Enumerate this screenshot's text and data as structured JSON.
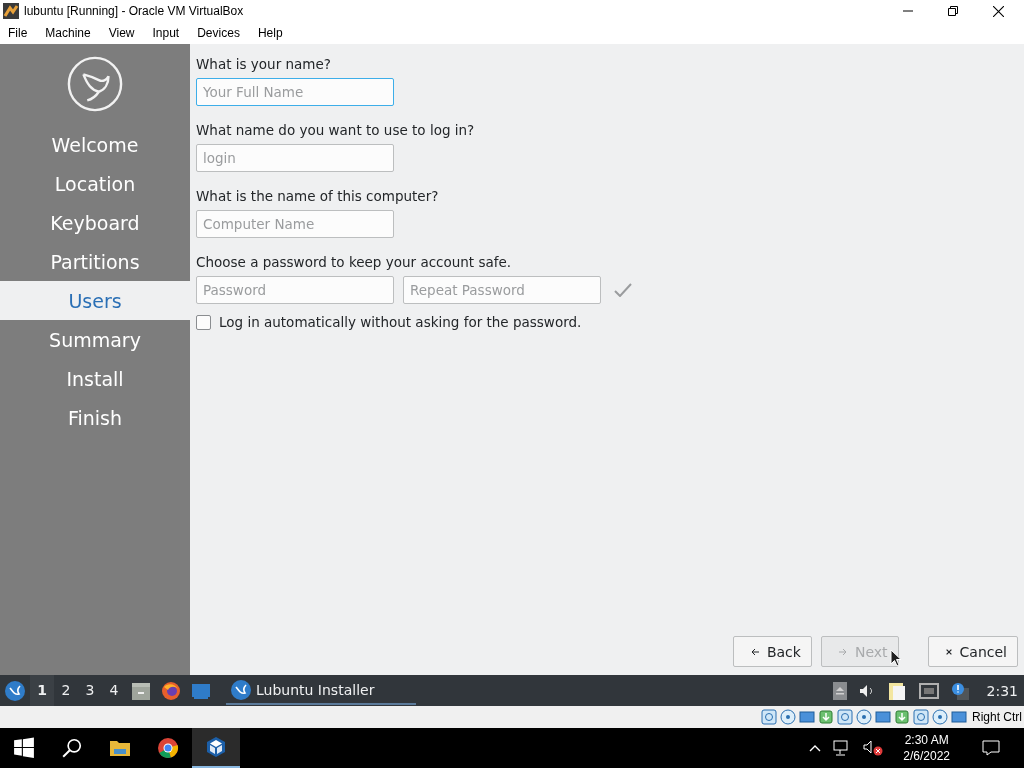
{
  "window": {
    "title": "lubuntu [Running] - Oracle VM VirtualBox"
  },
  "menu": [
    "File",
    "Machine",
    "View",
    "Input",
    "Devices",
    "Help"
  ],
  "installer": {
    "steps": [
      {
        "label": "Welcome",
        "selected": false
      },
      {
        "label": "Location",
        "selected": false
      },
      {
        "label": "Keyboard",
        "selected": false
      },
      {
        "label": "Partitions",
        "selected": false
      },
      {
        "label": "Users",
        "selected": true
      },
      {
        "label": "Summary",
        "selected": false
      },
      {
        "label": "Install",
        "selected": false
      },
      {
        "label": "Finish",
        "selected": false
      }
    ],
    "form": [
      {
        "label": "What is your name?",
        "inputs": [
          {
            "placeholder": "Your Full Name",
            "focused": true
          }
        ]
      },
      {
        "label": "What name do you want to use to log in?",
        "inputs": [
          {
            "placeholder": "login",
            "focused": false
          }
        ]
      },
      {
        "label": "What is the name of this computer?",
        "inputs": [
          {
            "placeholder": "Computer Name",
            "focused": false
          }
        ]
      },
      {
        "label": "Choose a password to keep your account safe.",
        "inputs": [
          {
            "placeholder": "Password",
            "focused": false
          },
          {
            "placeholder": "Repeat Password",
            "focused": false
          }
        ]
      }
    ],
    "autologin": {
      "label": "Log in automatically without asking for the password.",
      "checked": false
    },
    "buttons": [
      {
        "kind": "back",
        "label": "Back",
        "disabled": false
      },
      {
        "kind": "next",
        "label": "Next",
        "disabled": true
      },
      {
        "kind": "cancel",
        "label": "Cancel",
        "disabled": false
      }
    ]
  },
  "vm_panel": {
    "desktops": [
      {
        "label": "1",
        "selected": true
      },
      {
        "label": "2",
        "selected": false
      },
      {
        "label": "3",
        "selected": false
      },
      {
        "label": "4",
        "selected": false
      }
    ],
    "task": {
      "label": "Lubuntu Installer"
    },
    "clock": "2:31"
  },
  "vbox_status": {
    "host_key": "Right Ctrl"
  },
  "host_taskbar": {
    "time": "2:30 AM",
    "date": "2/6/2022"
  }
}
